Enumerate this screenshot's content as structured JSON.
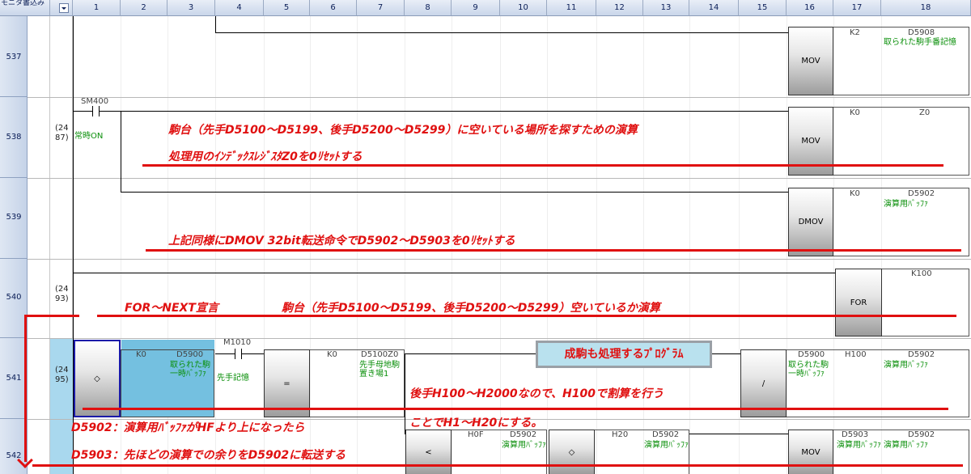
{
  "header": {
    "first_col_label": "モニタ書込み",
    "columns": [
      "1",
      "2",
      "3",
      "4",
      "5",
      "6",
      "7",
      "8",
      "9",
      "10",
      "11",
      "12",
      "13",
      "14",
      "15",
      "16",
      "17",
      "18"
    ]
  },
  "rows": [
    {
      "step": "537",
      "pointer": ""
    },
    {
      "step": "538",
      "pointer": "(24\n87)"
    },
    {
      "step": "539",
      "pointer": ""
    },
    {
      "step": "540",
      "pointer": "(24\n93)"
    },
    {
      "step": "541",
      "pointer": "(24\n95)"
    },
    {
      "step": "542",
      "pointer": ""
    }
  ],
  "ladder": {
    "r537": {
      "op": "MOV",
      "src": "K2",
      "dst": "D5908",
      "dst_comment": "取られた駒手番記憶"
    },
    "r538": {
      "contact_dev": "SM400",
      "contact_comment": "常時ON",
      "op": "MOV",
      "src": "K0",
      "dst": "Z0"
    },
    "r539": {
      "op": "DMOV",
      "src": "K0",
      "dst": "D5902",
      "dst_comment": "演算用ﾊﾞｯﾌｧ"
    },
    "r540": {
      "op": "FOR",
      "src": "K100"
    },
    "r541": {
      "cmp1_op": "◇",
      "cmp1_a": "K0",
      "cmp1_b": "D5900",
      "cmp1_b_comment": "取られた駒一時ﾊﾞｯﾌｧ",
      "contact_dev": "M1010",
      "contact_comment": "先手記憶",
      "cmp2_op": "=",
      "cmp2_a": "K0",
      "cmp2_b": "D5100Z0",
      "cmp2_b_comment": "先手母地駒置き場1",
      "div_op": "/",
      "div_a": "D5900",
      "div_a_comment": "取られた駒一時ﾊﾞｯﾌｧ",
      "div_b": "H100",
      "div_dst": "D5902",
      "div_dst_comment": "演算用ﾊﾞｯﾌｧ"
    },
    "r542": {
      "cmp1_op": "<",
      "cmp1_a": "H0F",
      "cmp1_b": "D5902",
      "cmp1_b_comment": "演算用ﾊﾞｯﾌｧ",
      "cmp2_op": "◇",
      "cmp2_a": "H20",
      "cmp2_b": "D5902",
      "cmp2_b_comment": "演算用ﾊﾞｯﾌｧ",
      "mov_op": "MOV",
      "mov_src": "D5903",
      "mov_src_comment": "演算用ﾊﾞｯﾌｧ",
      "mov_dst": "D5902",
      "mov_dst_comment": "演算用ﾊﾞｯﾌｧ"
    }
  },
  "annotations": {
    "a1": "駒台（先手D5100～D5199、後手D5200～D5299）に空いている場所を探すための演算",
    "a2": "処理用のｲﾝﾃﾞｯｸｽﾚｼﾞｽﾀZ0を0ﾘｾｯﾄする",
    "a3": "上記同様にDMOV 32bit転送命令でD5902～D5903を0ﾘｾｯﾄする",
    "a4": "FOR～NEXT宣言",
    "a5": "駒台（先手D5100～D5199、後手D5200～D5299）空いているか演算",
    "a6": "成駒も処理するﾌﾟﾛｸﾞﾗﾑ",
    "a7": "後手H100～H2000なので、H100で割算を行う",
    "a8": "ことでH1～H20にする。",
    "a9": "D5902：演算用ﾊﾞｯﾌｧがHFより上になったら",
    "a10": "D5903：先ほどの演算での余りをD5902に転送する"
  },
  "colors": {
    "accent_red": "#e01010",
    "comment_green": "#0a8f0a",
    "header_blue": "#0b1e57",
    "highlight": "#74c0e0"
  }
}
